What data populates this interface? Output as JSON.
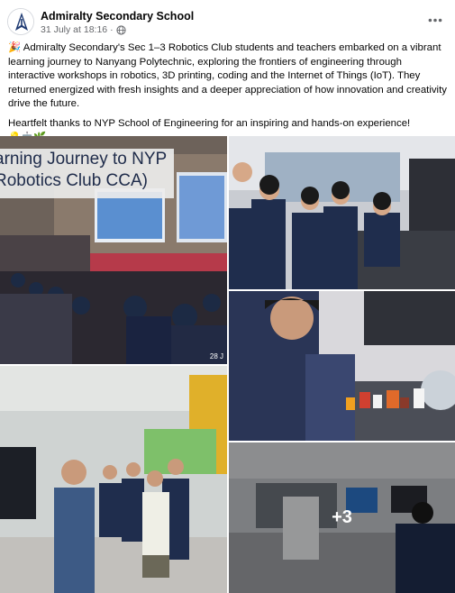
{
  "post": {
    "author": "Admiralty Secondary School",
    "timestamp": "31 July at 18:16",
    "separator": "·",
    "privacy_icon": "globe-icon",
    "more_icon": "more-horizontal-icon",
    "paragraph1_emoji": "🎉",
    "paragraph1": "Admiralty Secondary's Sec 1–3 Robotics Club students and teachers embarked on a vibrant learning journey to Nanyang Polytechnic, exploring the frontiers of engineering through interactive workshops in robotics, 3D printing, coding and the Internet of Things (IoT). They returned energized with fresh insights and a deeper appreciation of how innovation and creativity drive the future.",
    "paragraph2": "Heartfelt thanks to NYP School of Engineering for an inspiring and hands-on experience!",
    "paragraph2_emojis": "💡🤖🌿"
  },
  "gallery": {
    "photo1_banner_line1": "arning Journey to NYP",
    "photo1_banner_line2": "Robotics Club CCA)",
    "photo1_date": "28 J",
    "more_count": "+3"
  }
}
